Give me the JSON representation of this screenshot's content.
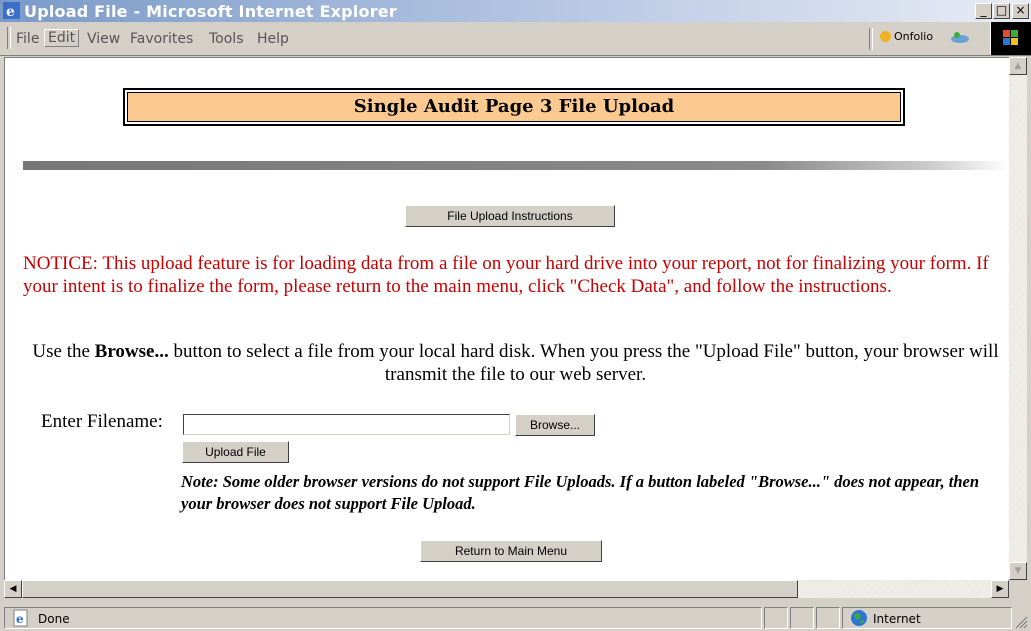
{
  "window": {
    "title": "Upload File - Microsoft Internet Explorer",
    "minimize": "_",
    "maximize": "□",
    "close": "×"
  },
  "menu": {
    "items": [
      "File",
      "Edit",
      "View",
      "Favorites",
      "Tools",
      "Help"
    ],
    "toolbar_label": "Onfolio"
  },
  "page": {
    "heading": "Single Audit Page 3 File Upload",
    "instructions_button": "File Upload Instructions",
    "notice": "NOTICE: This upload feature is for loading data from a file on your hard drive into your report, not for finalizing your form. If your intent is to finalize the form, please return to the main menu, click \"Check Data\", and follow the instructions.",
    "browse_instr_pre": "Use the ",
    "browse_instr_bold": "Browse...",
    "browse_instr_post": " button to select a file from your local hard disk. When you press the \"Upload File\" button, your browser will transmit the file to our web server.",
    "filename_label": "Enter Filename:",
    "filename_value": "",
    "browse_button": "Browse...",
    "upload_button": "Upload File",
    "note": "Note: Some older browser versions do not support File Uploads. If a button labeled \"Browse...\" does not appear, then your browser does not support File Upload.",
    "return_button": "Return to Main Menu"
  },
  "status": {
    "text": "Done",
    "zone": "Internet"
  },
  "colors": {
    "heading_bg": "#fcc990",
    "notice_text": "#c80000",
    "titlebar": "#7a9ac8"
  },
  "icons": [
    "ie-app-icon",
    "onfolio-icon",
    "messenger-icon",
    "windows-logo-icon",
    "ie-page-icon",
    "globe-icon"
  ]
}
